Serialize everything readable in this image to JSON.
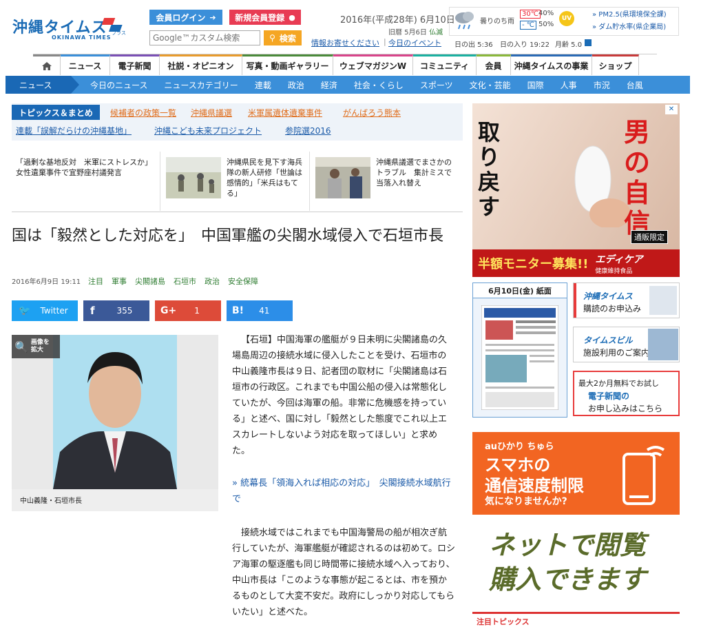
{
  "header": {
    "logo_jp": "沖縄タイムス",
    "logo_en": "OKINAWA TIMES",
    "logo_plus": "プラス",
    "login_button": "会員ログイン",
    "register_button": "新規会員登録",
    "search_placeholder": "Google™カスタム検索",
    "search_button": "検索",
    "date": "2016年(平成28年) 6月10日",
    "lunar": "旧暦 5月6日",
    "rokuyo": "仏滅",
    "info_link": "情報お寄せください",
    "event_link": "今日のイベント",
    "weather_text": "曇りのち雨",
    "temp_high": "30℃",
    "temp_low": "- ℃",
    "rain1": "40%",
    "rain2": "50%",
    "uv": "UV",
    "pm_link": "» PM2.5(県環境保全課)",
    "dam_link": "» ダム貯水率(県企業局)",
    "sunrise": "日の出 5:36",
    "sunset": "日の入り 19:22",
    "moon": "月齢 5.0"
  },
  "nav": {
    "home_icon": "home-icon",
    "items": [
      "ニュース",
      "電子新聞",
      "社説・オピニオン",
      "写真・動画ギャラリー",
      "ウェブマガジンW",
      "コミュニティ",
      "会員",
      "沖縄タイムスの事業",
      "ショップ"
    ]
  },
  "subnav": {
    "current": "ニュース",
    "items": [
      "今日のニュース",
      "ニュースカテゴリー",
      "連載",
      "政治",
      "経済",
      "社会・くらし",
      "スポーツ",
      "文化・芸能",
      "国際",
      "人事",
      "市況",
      "台風"
    ]
  },
  "topics": {
    "label": "トピックス＆まとめ",
    "links": [
      "候補者の政策一覧",
      "沖縄県議選",
      "米軍属遺体遺棄事件",
      "がんばろう熊本",
      "連載「誤解だらけの沖縄基地」",
      "沖縄こども未来プロジェクト",
      "参院選2016"
    ]
  },
  "headlines": [
    {
      "text": "「過剰な基地反対　米軍にストレスか」女性遺棄事件で宜野座村議発言"
    },
    {
      "text": "沖縄県民を見下す海兵隊の新人研修「世論は感情的」「米兵はもてる」"
    },
    {
      "text": "沖縄県議選でまさかのトラブル　集計ミスで当落入れ替え"
    }
  ],
  "article": {
    "title": "国は「毅然とした対応を」　中国軍艦の尖閣水域侵入で石垣市長",
    "datetime": "2016年6月9日 19:11",
    "tags": [
      "注目",
      "軍事",
      "尖閣諸島",
      "石垣市",
      "政治",
      "安全保障"
    ],
    "share": {
      "twitter": "Twitter",
      "facebook_count": "355",
      "gplus_count": "1",
      "hatena_count": "41"
    },
    "zoom_label": "画像を拡大",
    "photo_caption": "中山義隆・石垣市長",
    "body1": "【石垣】中国海軍の艦艇が９日未明に尖閣諸島の久場島周辺の接続水域に侵入したことを受け、石垣市の中山義隆市長は９日、記者団の取材に「尖閣諸島は石垣市の行政区。これまでも中国公船の侵入は常態化していたが、今回は海軍の船。非常に危機感を持っている」と述べ、国に対し「毅然とした態度でこれ以上エスカレートしないよう対応を取ってほしい」と求めた。",
    "related": "» 統幕長「領海入れば相応の対応」　尖閣接続水域航行で",
    "body2": "接続水域ではこれまでも中国海警局の船が相次ぎ航行していたが、海軍艦艇が確認されるのは初めて。ロシア海軍の駆逐艦も同じ時間帯に接続水域へ入っており、中山市長は「このような事態が起こるとは、市を預かるものとして大変不安だ。政府にしっかり対応してもらいたい」と述べた。"
  },
  "sidebar": {
    "ad1_line1": "男の自信",
    "ad1_line2": "取り戻す",
    "ad1_badge": "通販限定",
    "ad1_bottom": "半額モニター募集!!",
    "ad1_brand": "エディケア",
    "ad1_brand_sub": "健康維持食品",
    "paper_label": "6月10日(金) 紙面",
    "banner1_title": "沖縄タイムス",
    "banner1_sub": "購読のお申込み",
    "banner2_title": "タイムスビル",
    "banner2_sub": "施設利用のご案内",
    "banner3_top": "最大2か月無料でお試し",
    "banner3_mid": "電子新聞の",
    "banner3_sub": "お申し込みはこちら",
    "ad2_top": "auひかり ちゅら",
    "ad2_l1": "スマホの",
    "ad2_l2": "通信速度制限",
    "ad2_l3": "気になりませんか?",
    "ad3_l1": "ネットで閲覧",
    "ad3_l2": "購入できます",
    "bottom_label": "注目トピックス"
  }
}
